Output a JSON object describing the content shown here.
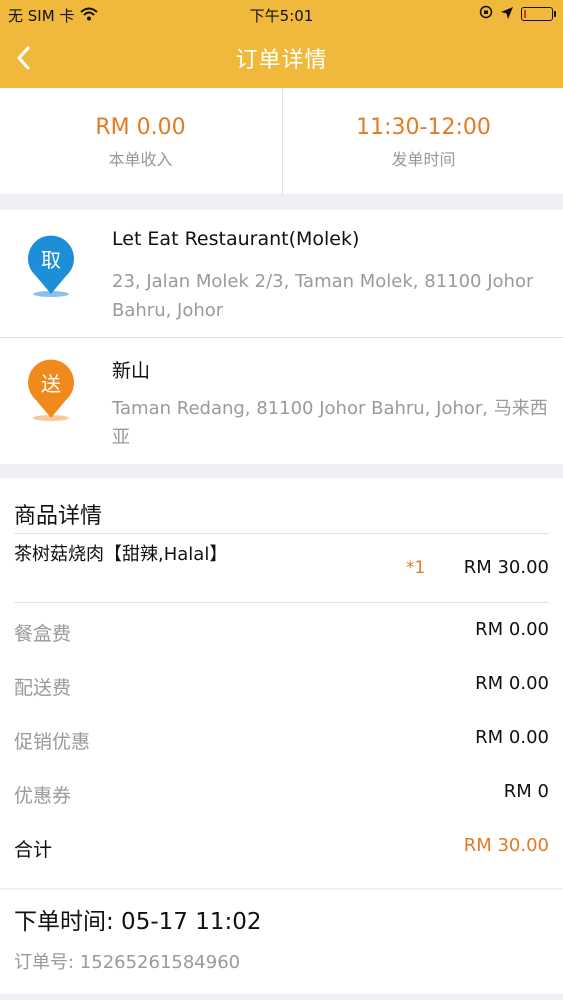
{
  "status_bar": {
    "carrier": "无 SIM 卡",
    "time": "下午5:01"
  },
  "nav": {
    "title": "订单详情",
    "back_icon": "chevron-left-icon"
  },
  "summary": {
    "income_value": "RM 0.00",
    "income_label": "本单收入",
    "time_value": "11:30-12:00",
    "time_label": "发单时间"
  },
  "pickup": {
    "badge": "取",
    "name": "Let Eat Restaurant(Molek)",
    "address": "23, Jalan Molek 2/3, Taman Molek, 81100 Johor Bahru, Johor",
    "color": "#1c8fd8"
  },
  "delivery": {
    "badge": "送",
    "name": "新山",
    "address": "Taman Redang, 81100 Johor Bahru, Johor, 马来西亚",
    "color": "#f08a1c"
  },
  "details": {
    "title": "商品详情",
    "items": [
      {
        "name": "茶树菇烧肉【甜辣,Halal】",
        "qty": "*1",
        "price": "RM 30.00"
      }
    ],
    "fees": [
      {
        "label": "餐盒费",
        "value": "RM 0.00"
      },
      {
        "label": "配送费",
        "value": "RM 0.00"
      },
      {
        "label": "促销优惠",
        "value": "RM 0.00"
      },
      {
        "label": "优惠券",
        "value": "RM 0"
      }
    ],
    "total": {
      "label": "合计",
      "value": "RM 30.00"
    }
  },
  "order": {
    "time": "下单时间: 05-17 11:02",
    "number": "订单号: 15265261584960"
  },
  "colors": {
    "header": "#f1b93b",
    "accent": "#e27b22"
  }
}
